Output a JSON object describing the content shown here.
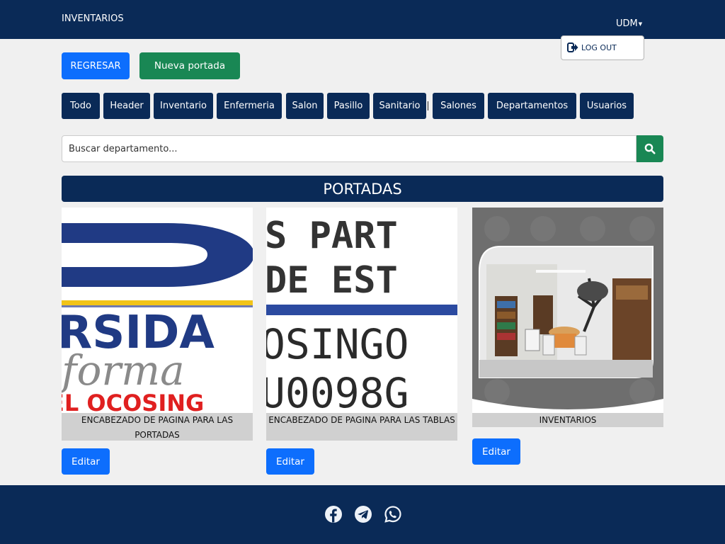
{
  "header": {
    "brand": "INVENTARIOS",
    "user": "UDM",
    "logout": "LOG OUT"
  },
  "actions": {
    "back": "REGRESAR",
    "new": "Nueva portada"
  },
  "filters": [
    "Todo",
    "Header",
    "Inventario",
    "Enfermeria",
    "Salon",
    "Pasillo",
    "Sanitario",
    "Salones",
    "Departamentos",
    "Usuarios"
  ],
  "search": {
    "placeholder": "Buscar departamento..."
  },
  "section_title": "PORTADAS",
  "cards": [
    {
      "caption": "ENCABEZADO DE PAGINA PARA LAS PORTADAS",
      "image_text": [
        "RSIDA",
        "forma",
        "EL OCOSING"
      ],
      "edit": "Editar"
    },
    {
      "caption": "ENCABEZADO DE PAGINA PARA LAS TABLAS",
      "image_text": [
        "S PART",
        "DE EST",
        "OSINGO",
        "U0098G"
      ],
      "edit": "Editar"
    },
    {
      "caption": "INVENTARIOS",
      "edit": "Editar"
    }
  ],
  "footer": {
    "icons": [
      "facebook-icon",
      "telegram-icon",
      "whatsapp-icon"
    ]
  },
  "colors": {
    "navy": "#0a2a57",
    "primary": "#0d6efd",
    "success": "#198754",
    "page_bg": "#f0f0f0"
  }
}
